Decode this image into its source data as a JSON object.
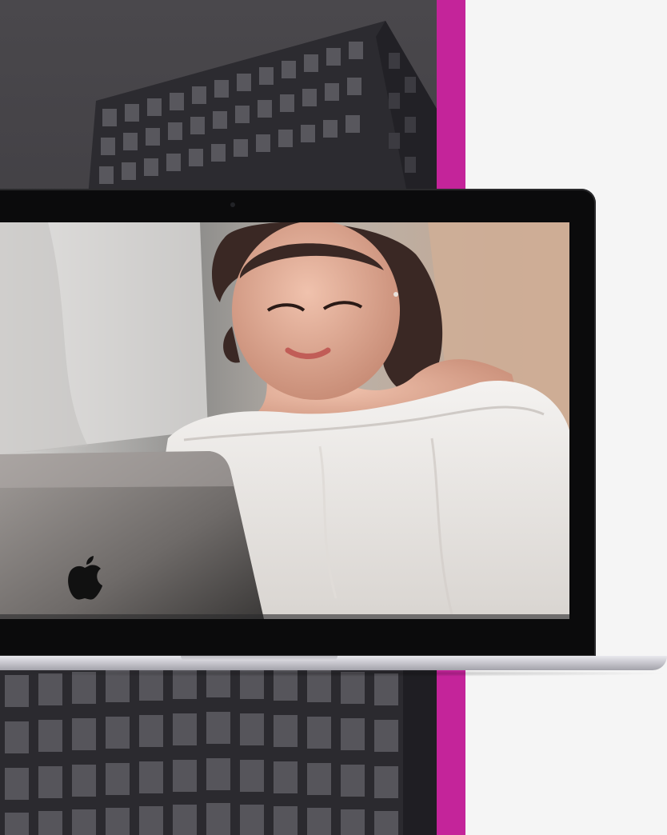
{
  "colors": {
    "accent_magenta": "#c4249a",
    "building_dark": "#3d3b40",
    "background_light": "#f5f5f5",
    "laptop_bezel": "#0b0b0c",
    "laptop_silver": "#c9c8cf"
  },
  "icons": {
    "laptop_logo": "apple-logo-icon"
  },
  "scene": {
    "elements": [
      "building-photo",
      "magenta-accent-bar",
      "laptop-mockup",
      "screen-photo-woman-with-laptop"
    ]
  }
}
